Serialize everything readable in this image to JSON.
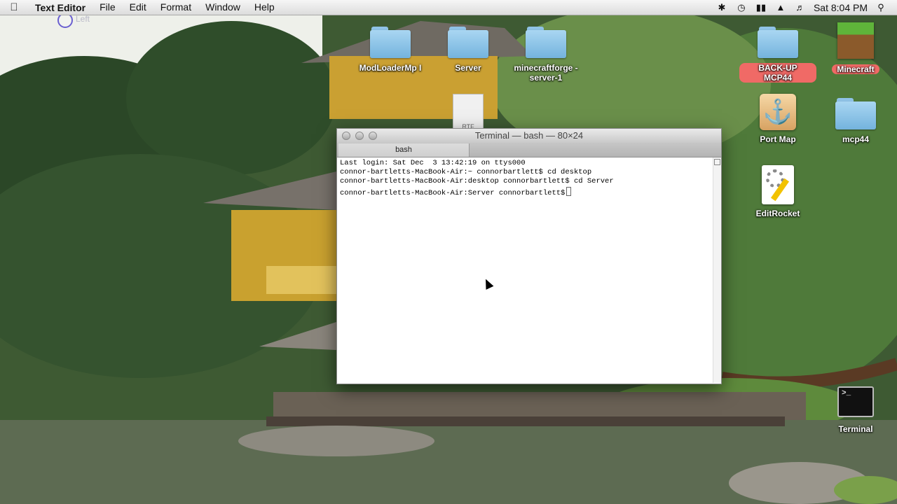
{
  "menubar": {
    "apple_icon": "apple-logo",
    "app_name": "Text Editor",
    "items": [
      "File",
      "Edit",
      "Format",
      "Window",
      "Help"
    ],
    "status": {
      "icons": [
        "bluetooth-icon",
        "time-machine-icon",
        "battery-icon",
        "wifi-icon",
        "volume-icon"
      ],
      "clock": "Sat 8:04 PM",
      "spotlight_icon": "search-icon"
    }
  },
  "indicator": {
    "label": "Left"
  },
  "desktop_icons": [
    {
      "label": "ModLoaderMp I",
      "kind": "folder"
    },
    {
      "label": "Server",
      "kind": "folder"
    },
    {
      "label": "minecraftforge -server-1",
      "kind": "folder"
    },
    {
      "label": "BACK-UP MCP44",
      "kind": "folder"
    },
    {
      "label": "Minecraft",
      "kind": "app"
    },
    {
      "label": "Port Map",
      "kind": "app"
    },
    {
      "label": "mcp44",
      "kind": "folder"
    },
    {
      "label": "EditRocket",
      "kind": "app"
    },
    {
      "label": "Terminal",
      "kind": "app"
    }
  ],
  "label_colors": {
    "highlight": "#f06a66"
  },
  "doc_icon": {
    "label": "RTF"
  },
  "terminal": {
    "title": "Terminal — bash — 80×24",
    "tab": "bash",
    "lines": [
      "Last login: Sat Dec  3 13:42:19 on ttys000",
      "connor-bartletts-MacBook-Air:~ connorbartlett$ cd desktop",
      "connor-bartletts-MacBook-Air:desktop connorbartlett$ cd Server",
      "connor-bartletts-MacBook-Air:Server connorbartlett$"
    ]
  }
}
